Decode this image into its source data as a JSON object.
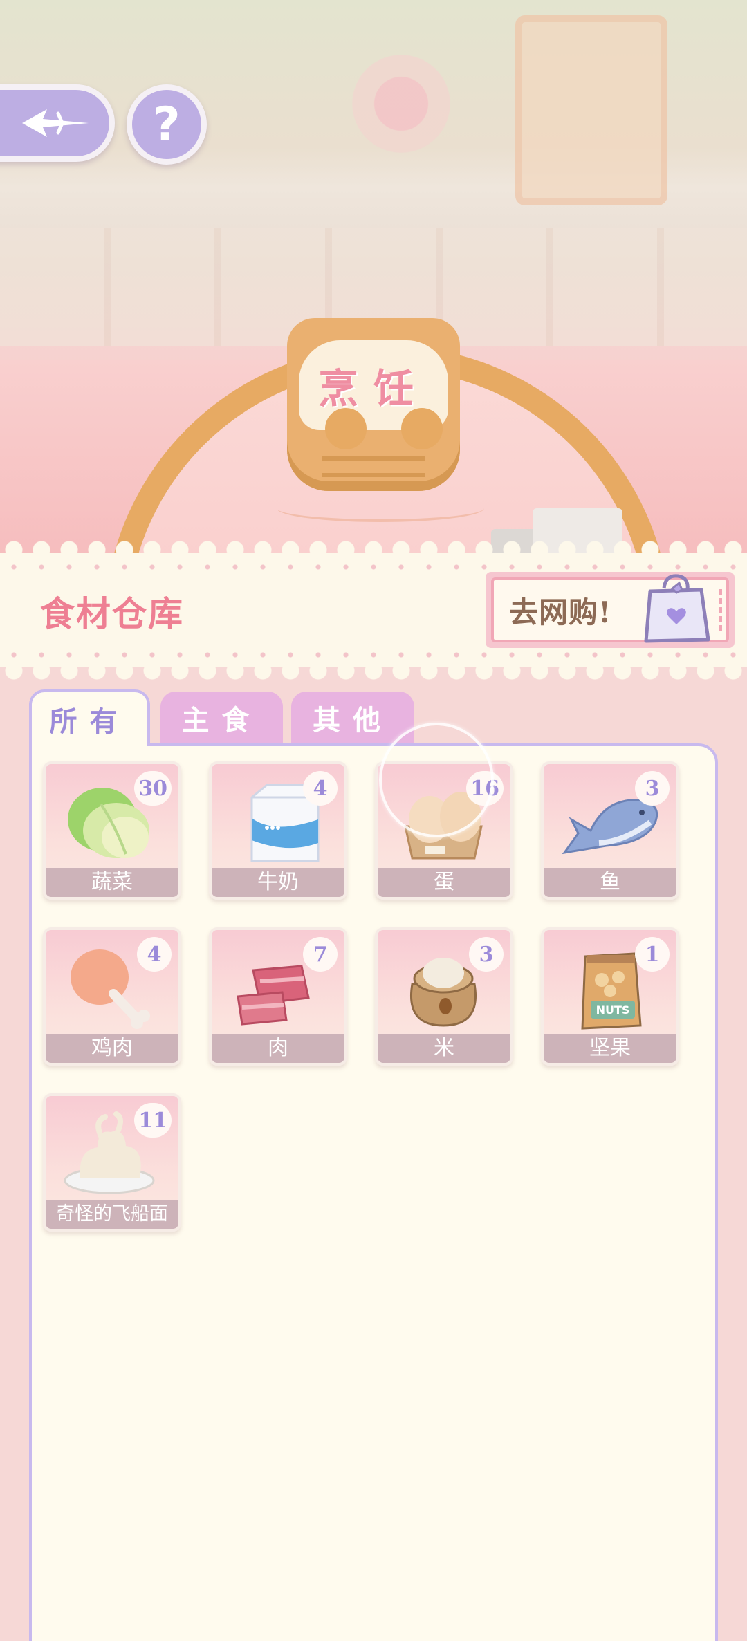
{
  "scene": {
    "sign_title": "烹饪"
  },
  "header": {
    "title": "食材仓库",
    "shop_label": "去网购!"
  },
  "tabs": [
    {
      "label": "所有",
      "active": true
    },
    {
      "label": "主食",
      "active": false
    },
    {
      "label": "其他",
      "active": false
    }
  ],
  "items": [
    {
      "name": "蔬菜",
      "count": "30",
      "icon": "cabbage-icon"
    },
    {
      "name": "牛奶",
      "count": "4",
      "icon": "milk-carton-icon"
    },
    {
      "name": "蛋",
      "count": "16",
      "icon": "eggs-icon"
    },
    {
      "name": "鱼",
      "count": "3",
      "icon": "fish-icon"
    },
    {
      "name": "鸡肉",
      "count": "4",
      "icon": "chicken-leg-icon"
    },
    {
      "name": "肉",
      "count": "7",
      "icon": "meat-icon"
    },
    {
      "name": "米",
      "count": "3",
      "icon": "rice-sack-icon"
    },
    {
      "name": "坚果",
      "count": "1",
      "icon": "nuts-bag-icon"
    },
    {
      "name": "奇怪的飞船面",
      "count": "11",
      "icon": "strange-noodles-icon"
    }
  ],
  "nuts_bag_text": "NUTS",
  "colors": {
    "accent_purple": "#9b8ad9",
    "title_pink": "#ee7f93",
    "panel_cream": "#fffbee",
    "button_lavender": "#bdaee3"
  }
}
